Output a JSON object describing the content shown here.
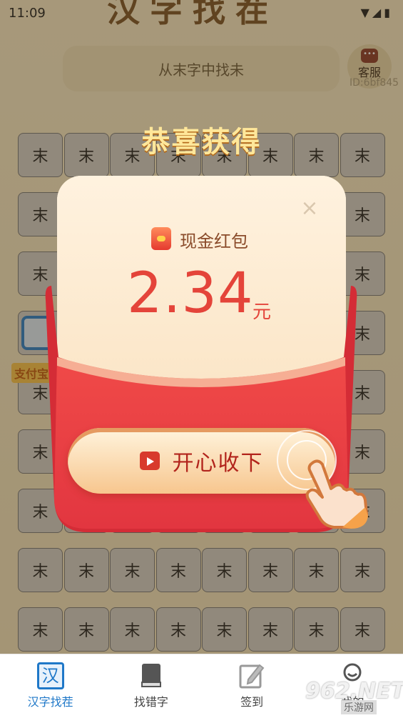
{
  "status_bar": {
    "time": "11:09",
    "icons": "▼◢▮"
  },
  "game": {
    "title": "汉字找茬",
    "search_text": "从末字中找未",
    "service_label": "客服",
    "user_id": "ID:6bf845",
    "cell_char": "末",
    "rows": 9,
    "cols": 8,
    "pay_label": "支付宝"
  },
  "reward": {
    "congrats": "恭喜获得",
    "type_label": "现金红包",
    "amount": "2.34",
    "unit": "元",
    "close_icon": "×",
    "collect_label": "开心收下"
  },
  "bottom_nav": {
    "items": [
      {
        "label": "汉字找茬",
        "icon": "汉",
        "active": true
      },
      {
        "label": "找错字",
        "icon": "book-icon",
        "active": false
      },
      {
        "label": "签到",
        "icon": "pen-icon",
        "active": false
      },
      {
        "label": "我的",
        "icon": "face-icon",
        "active": false
      }
    ]
  },
  "watermark": {
    "text": "962.NET",
    "sub": "乐游网"
  },
  "colors": {
    "accent_red": "#e4443a",
    "nav_active": "#1f78c8",
    "gold": "#ffe79a"
  }
}
